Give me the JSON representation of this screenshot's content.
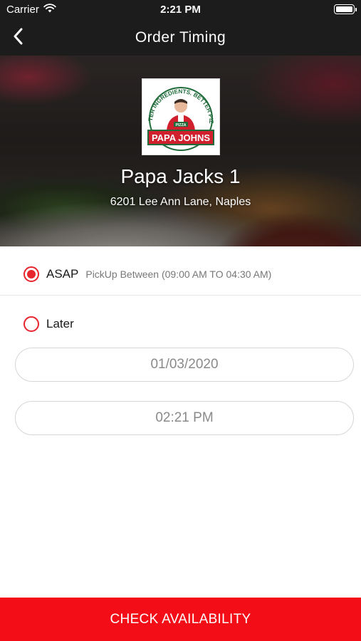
{
  "status_bar": {
    "carrier": "Carrier",
    "time": "2:21 PM"
  },
  "nav": {
    "title": "Order Timing"
  },
  "store": {
    "name": "Papa Jacks 1",
    "address": "6201 Lee Ann Lane, Naples",
    "logo_arc_text": "BETTER INGREDIENTS. BETTER PIZZA.",
    "logo_badge_small": "PIZZA",
    "logo_wordmark": "PAPA JOHNS"
  },
  "options": {
    "asap": {
      "label": "ASAP",
      "note": "PickUp Between (09:00 AM TO 04:30 AM)",
      "selected": true
    },
    "later": {
      "label": "Later",
      "selected": false,
      "date_value": "01/03/2020",
      "time_value": "02:21 PM"
    }
  },
  "cta": {
    "label": "CHECK AVAILABILITY"
  },
  "colors": {
    "accent": "#e8242c",
    "cta_background": "#f20d17",
    "nav_background": "#1c1c1c",
    "logo_green": "#1f6b3a",
    "logo_red": "#d0202e"
  },
  "icons": {
    "back": "chevron-left-icon",
    "wifi": "wifi-icon",
    "battery": "battery-icon"
  }
}
